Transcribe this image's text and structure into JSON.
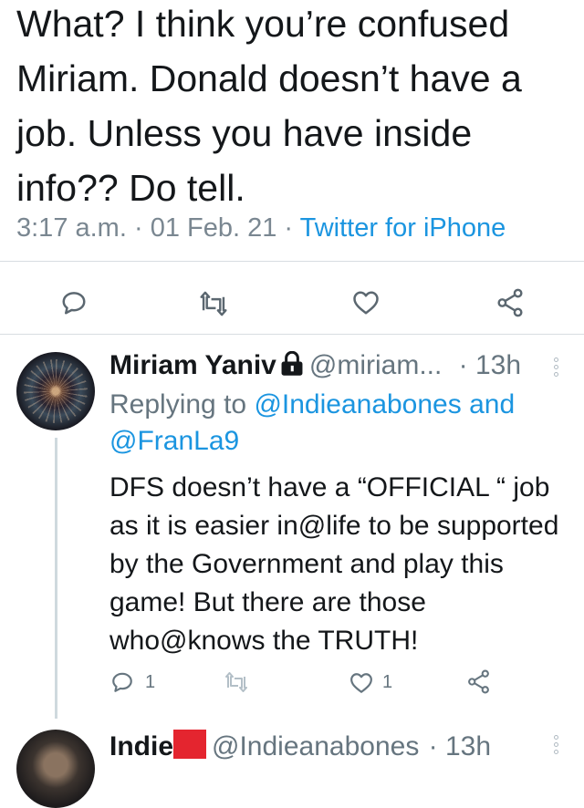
{
  "main_tweet": {
    "text": "What? I think you’re confused Miriam. Donald doesn’t have a job. Unless you have inside info?? Do tell.",
    "time": "3:17 a.m.",
    "date": "01 Feb. 21",
    "source": "Twitter for iPhone",
    "separator": " · "
  },
  "reply": {
    "name": "Miriam Yaniv",
    "handle": "@miriam...",
    "time_ago": "· 13h",
    "replying_label": "Replying to ",
    "replying_to_1": "@Indieanabones",
    "replying_and": " and",
    "replying_to_2": "@FranLa9",
    "text": "DFS doesn’t have a “OFFICIAL “ job as it is easier in@life to be supported by the Government and play this game! But there are those who@knows the TRUTH!",
    "reply_count": "1",
    "like_count": "1"
  },
  "next_reply": {
    "name": "Indie",
    "handle": "@Indieanabones",
    "time_ago": "· 13h"
  },
  "icons": {
    "reply": "reply-icon",
    "retweet": "retweet-icon",
    "like": "heart-icon",
    "share": "share-icon",
    "more": "more-vertical-icon",
    "lock": "lock-icon"
  },
  "colors": {
    "text": "#14171a",
    "secondary": "#7a8791",
    "link": "#1b95e0",
    "flag": "#e4252f"
  }
}
